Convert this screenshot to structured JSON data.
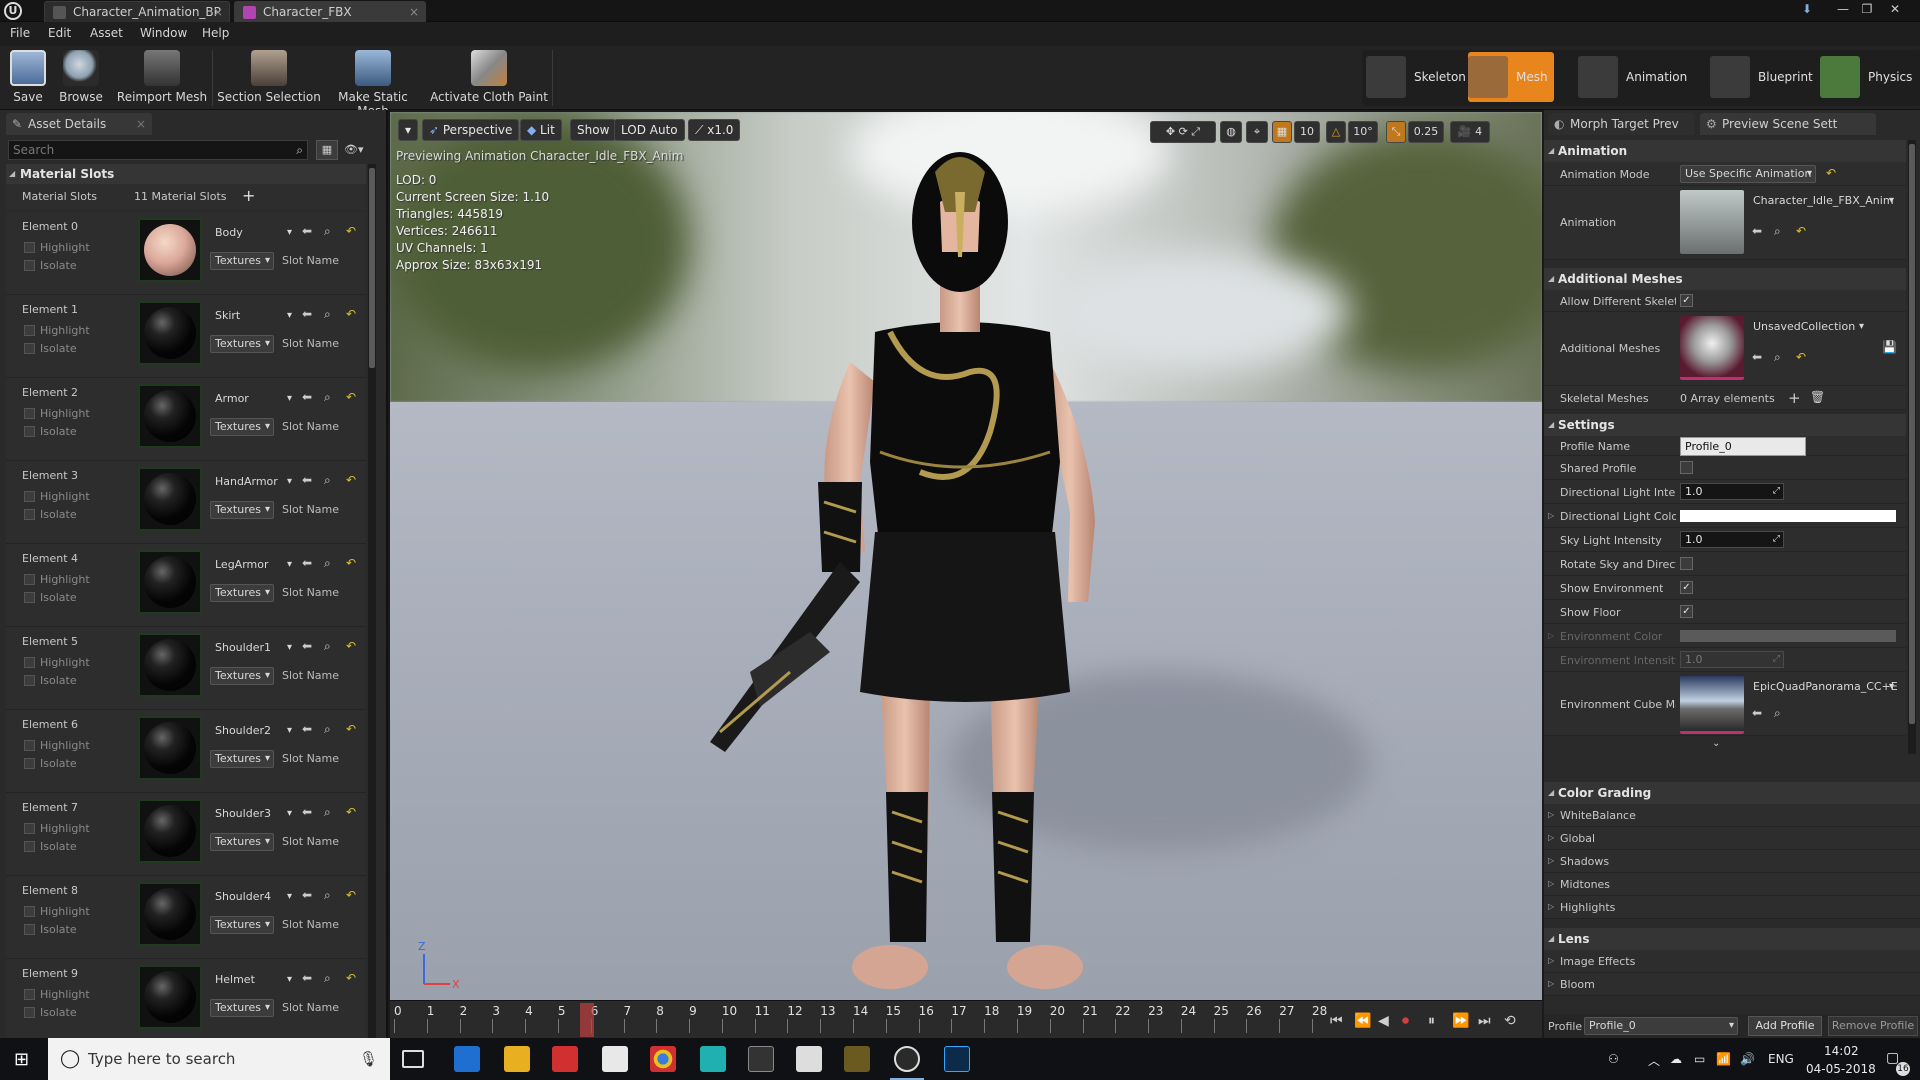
{
  "titlebar": {
    "tabs": [
      {
        "label": "Character_Animation_BP",
        "color": "#555555"
      },
      {
        "label": "Character_FBX",
        "color": "#b045b0"
      }
    ]
  },
  "menu": [
    "File",
    "Edit",
    "Asset",
    "Window",
    "Help"
  ],
  "toolbar": {
    "buttons": [
      "Save",
      "Browse",
      "Reimport Mesh",
      "Section Selection",
      "Make Static Mesh",
      "Activate Cloth Paint"
    ],
    "modes": [
      "Skeleton",
      "Mesh",
      "Animation",
      "Blueprint",
      "Physics"
    ],
    "active_mode_color": "#e8851c"
  },
  "left_panel": {
    "tab": "Asset Details",
    "search_placeholder": "Search",
    "category": "Material Slots",
    "slots_label": "Material Slots",
    "slots_count": "11 Material Slots",
    "highlight_label": "Highlight",
    "isolate_label": "Isolate",
    "textures_label": "Textures",
    "slot_name_label": "Slot Name",
    "elements": [
      {
        "name": "Element 0",
        "material": "Body"
      },
      {
        "name": "Element 1",
        "material": "Skirt"
      },
      {
        "name": "Element 2",
        "material": "Armor"
      },
      {
        "name": "Element 3",
        "material": "HandArmor"
      },
      {
        "name": "Element 4",
        "material": "LegArmor"
      },
      {
        "name": "Element 5",
        "material": "Shoulder1"
      },
      {
        "name": "Element 6",
        "material": "Shoulder2"
      },
      {
        "name": "Element 7",
        "material": "Shoulder3"
      },
      {
        "name": "Element 8",
        "material": "Shoulder4"
      },
      {
        "name": "Element 9",
        "material": "Helmet"
      }
    ]
  },
  "viewport": {
    "buttons": [
      "Perspective",
      "Lit",
      "Show",
      "LOD Auto",
      "x1.0"
    ],
    "previewing": "Previewing Animation Character_Idle_FBX_Anim",
    "stats": [
      "LOD: 0",
      "Current Screen Size: 1.10",
      "Triangles: 445819",
      "Vertices: 246611",
      "UV Channels: 1",
      "Approx Size: 83x63x191"
    ],
    "grid_snap": "10",
    "rot_snap": "10°",
    "scale_snap": "0.25",
    "cam_speed": "4",
    "axis_z": "Z",
    "axis_x": "X"
  },
  "timeline": {
    "ticks": [
      "0",
      "1",
      "2",
      "3",
      "4",
      "5",
      "6",
      "7",
      "8",
      "9",
      "10",
      "11",
      "12",
      "13",
      "14",
      "15",
      "16",
      "17",
      "18",
      "19",
      "20",
      "21",
      "22",
      "23",
      "24",
      "25",
      "26",
      "27",
      "28"
    ],
    "playhead": 6
  },
  "right_panel": {
    "tabs": [
      "Morph Target Prev",
      "Preview Scene Sett"
    ],
    "animation": {
      "header": "Animation",
      "mode_label": "Animation Mode",
      "mode_value": "Use Specific Animation",
      "anim_label": "Animation",
      "anim_value": "Character_Idle_FBX_Anim"
    },
    "additional_meshes": {
      "header": "Additional Meshes",
      "allow_label": "Allow Different Skelet",
      "meshes_label": "Additional Meshes",
      "meshes_value": "UnsavedCollection",
      "skeletal_label": "Skeletal Meshes",
      "skeletal_value": "0 Array elements"
    },
    "settings": {
      "header": "Settings",
      "profile_name_label": "Profile Name",
      "profile_name_value": "Profile_0",
      "shared_label": "Shared Profile",
      "dir_intensity_label": "Directional Light Inten",
      "dir_intensity_value": "1.0",
      "dir_color_label": "Directional Light Colo",
      "sky_label": "Sky Light Intensity",
      "sky_value": "1.0",
      "rotate_label": "Rotate Sky and Direct",
      "show_env_label": "Show Environment",
      "show_floor_label": "Show Floor",
      "env_color_label": "Environment Color",
      "env_intensity_label": "Environment Intensity",
      "env_intensity_value": "1.0",
      "cube_label": "Environment Cube Ma",
      "cube_value": "EpicQuadPanorama_CC+E"
    },
    "color_grading": {
      "header": "Color Grading",
      "items": [
        "WhiteBalance",
        "Global",
        "Shadows",
        "Midtones",
        "Highlights"
      ]
    },
    "lens": {
      "header": "Lens",
      "items": [
        "Image Effects",
        "Bloom"
      ]
    },
    "footer": {
      "profile_label": "Profile",
      "profile_value": "Profile_0",
      "add": "Add Profile",
      "remove": "Remove Profile"
    }
  },
  "taskbar": {
    "search_placeholder": "Type here to search",
    "lang": "ENG",
    "time": "14:02",
    "date": "04-05-2018",
    "notif": "16"
  }
}
